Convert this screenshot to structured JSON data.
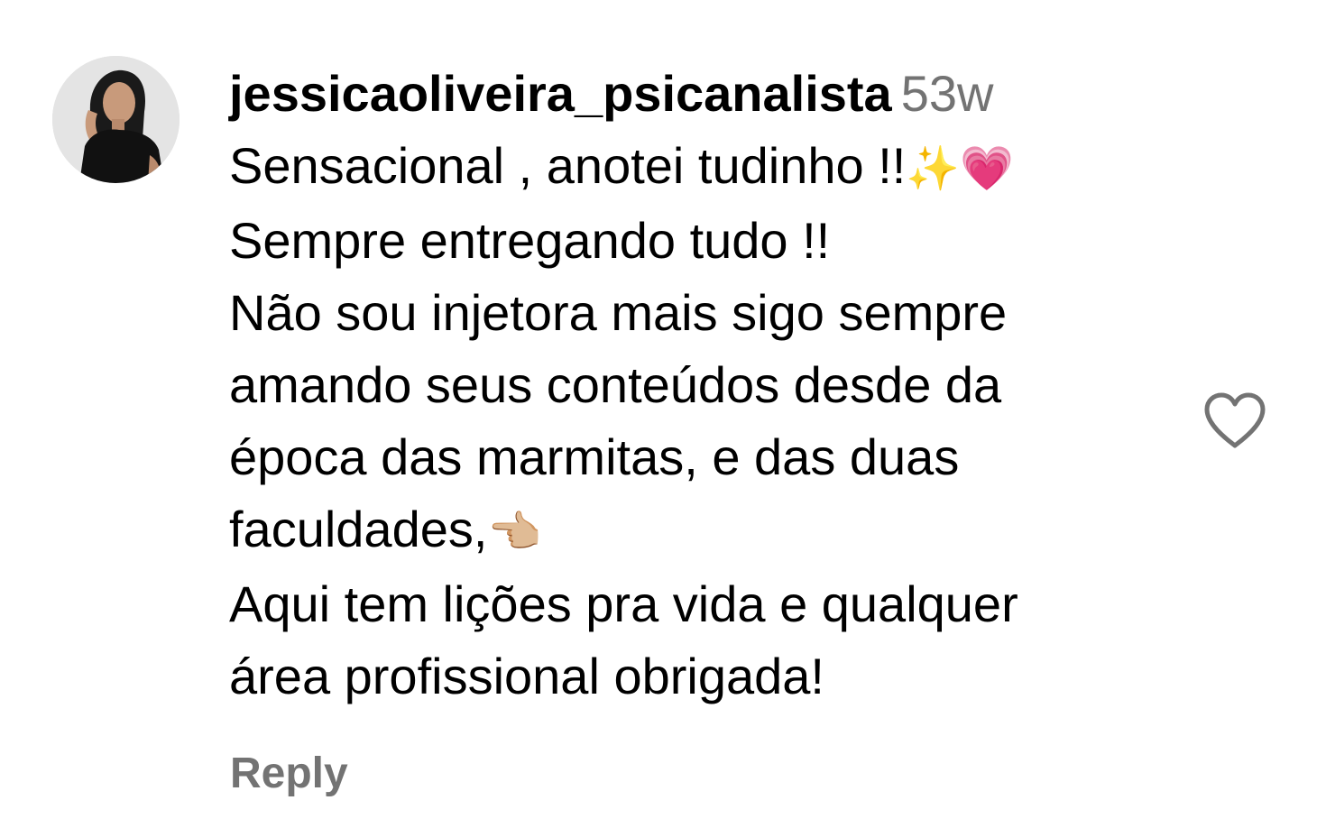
{
  "comment": {
    "username": "jessicaoliveira_psicanalista",
    "timestamp": "53w",
    "lines": [
      "Sensacional , anotei tudinho !!",
      "Sempre entregando tudo !!",
      "Não sou injetora mais sigo sempre",
      "amando seus conteúdos desde da",
      "época das marmitas, e das duas",
      "faculdades,",
      "Aqui tem lições pra vida e qualquer",
      "área profissional obrigada!"
    ],
    "line1_emojis": "✨💗",
    "line6_emoji": "👈🏼",
    "reply_label": "Reply",
    "like_icon": "heart-outline-icon",
    "avatar_icon": "profile-photo"
  },
  "colors": {
    "text": "#000000",
    "secondary": "#737373",
    "background": "#ffffff"
  }
}
